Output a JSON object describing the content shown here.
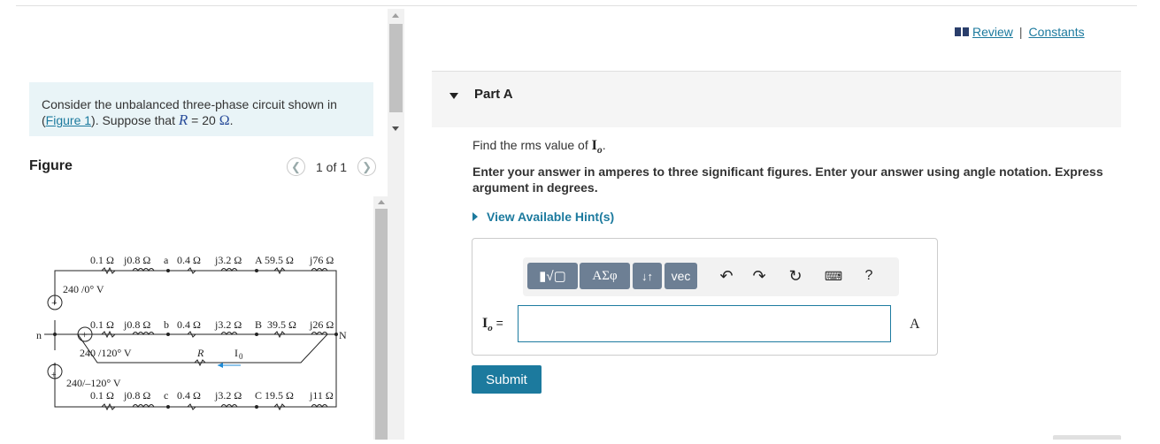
{
  "problem": {
    "text_before": "Consider the unbalanced three-phase circuit shown in",
    "figure_link": "Figure 1",
    "text_suppose": "). Suppose that",
    "var": "R",
    "equals": " = 20 ",
    "unit": "Ω",
    "end": "."
  },
  "figure": {
    "title": "Figure",
    "pager": "1 of 1",
    "circuit": {
      "row1": [
        "0.1 Ω",
        "j0.8 Ω",
        "a",
        "0.4 Ω",
        "j3.2 Ω",
        "A 59.5 Ω",
        "j76 Ω"
      ],
      "src1": "240 /0° V",
      "row2": [
        "0.1 Ω",
        "j0.8 Ω",
        "b",
        "0.4 Ω",
        "j3.2 Ω",
        "B",
        "39.5 Ω",
        "j26 Ω"
      ],
      "n": "n",
      "N": "N",
      "src2": "240 /120° V",
      "R": "R",
      "Io": "I",
      "Io_sub": "0",
      "src3": "240/–120° V",
      "row3": [
        "0.1 Ω",
        "j0.8 Ω",
        "c",
        "0.4 Ω",
        "j3.2 Ω",
        "C 19.5 Ω",
        "j11 Ω"
      ]
    }
  },
  "links": {
    "review": "Review",
    "separator": "|",
    "constants": "Constants"
  },
  "part": {
    "title": "Part A"
  },
  "question": {
    "text": "Find the rms value of",
    "var": "I",
    "sub": "o",
    "end": "."
  },
  "instructions": "Enter your answer in amperes to three significant figures. Enter your answer using angle notation. Express argument in degrees.",
  "hints_label": "View Available Hint(s)",
  "toolbar": {
    "templates": "▮√▢",
    "greek": "ΑΣφ",
    "arrows": "↓↑",
    "vec": "vec",
    "help": "?"
  },
  "answer": {
    "label_var": "I",
    "label_sub": "o",
    "label_eq": " =",
    "value": "",
    "unit": "A"
  },
  "submit_label": "Submit"
}
